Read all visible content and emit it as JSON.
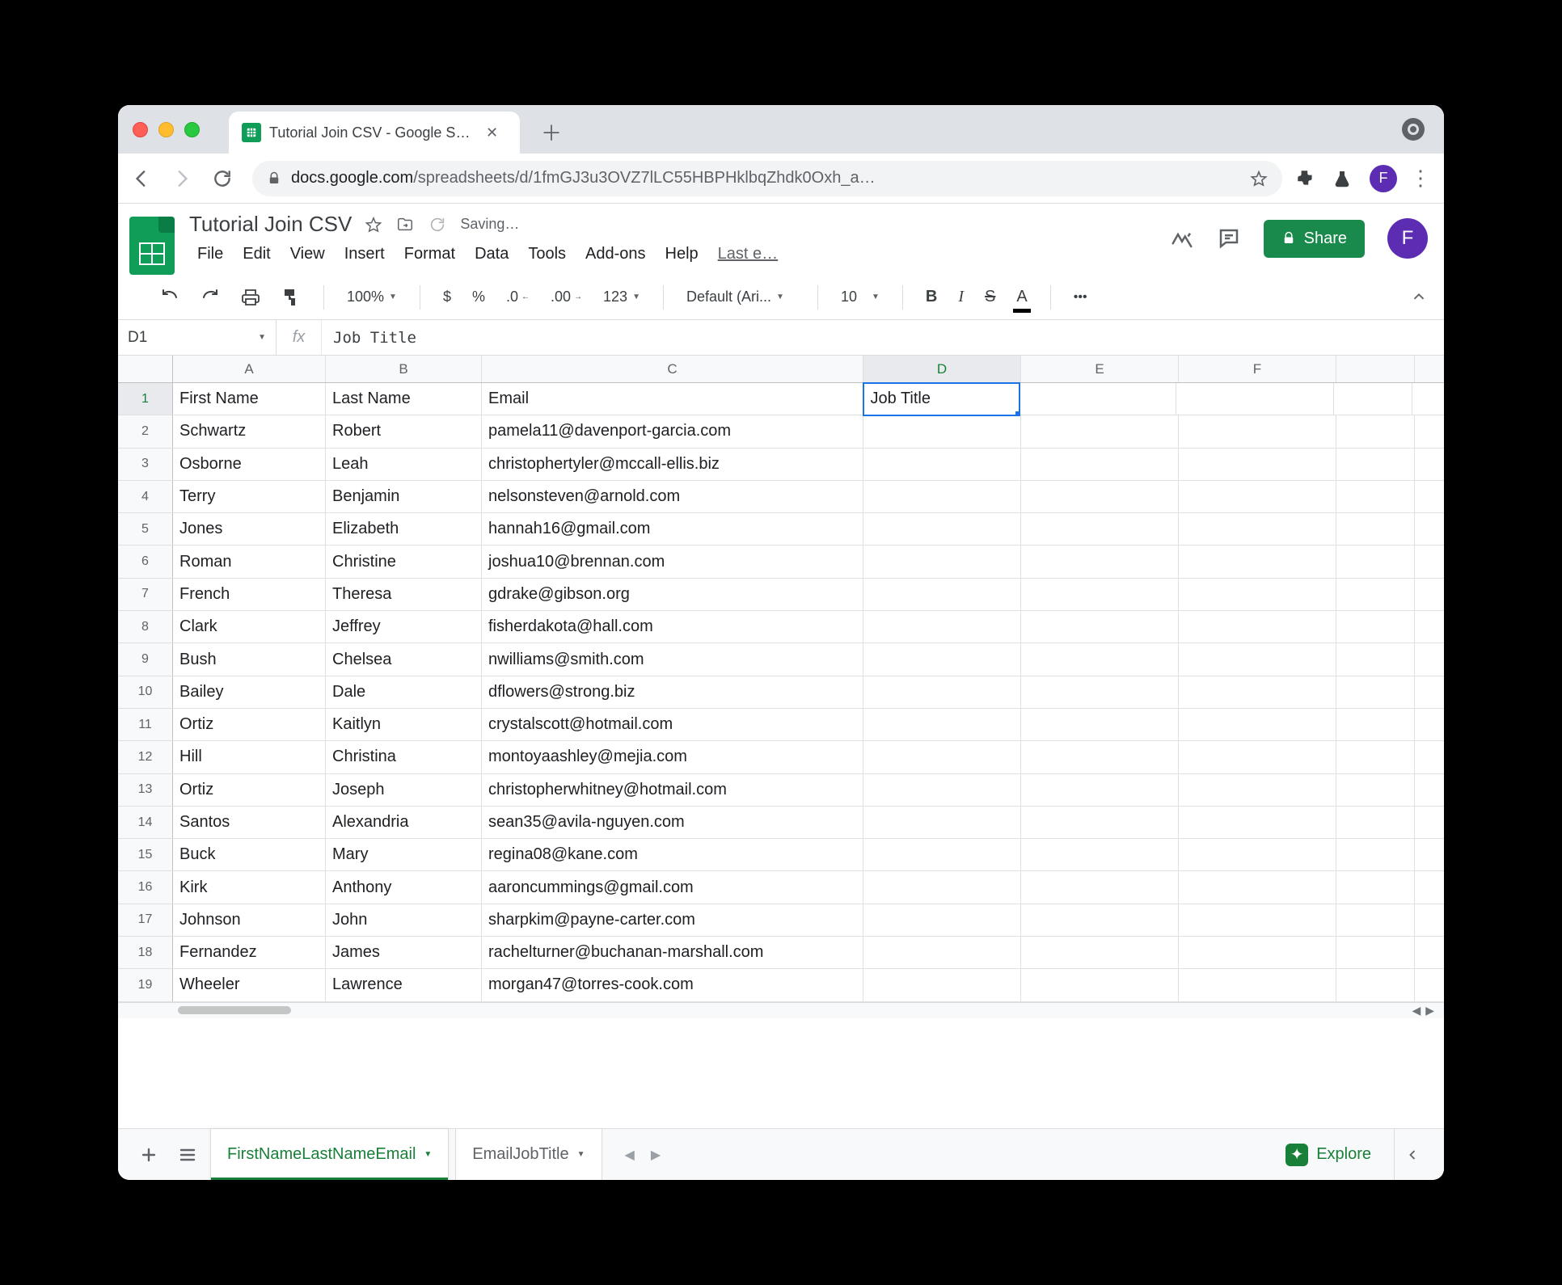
{
  "browser": {
    "tab_title": "Tutorial Join CSV - Google She",
    "url_host": "docs.google.com",
    "url_path": "/spreadsheets/d/1fmGJ3u3OVZ7lLC55HBPHklbqZhdk0Oxh_a…",
    "avatar_letter": "F"
  },
  "doc": {
    "title": "Tutorial Join CSV",
    "saving": "Saving…",
    "share_label": "Share",
    "avatar_letter": "F"
  },
  "menus": [
    "File",
    "Edit",
    "View",
    "Insert",
    "Format",
    "Data",
    "Tools",
    "Add-ons",
    "Help",
    "Last e…"
  ],
  "toolbar": {
    "zoom": "100%",
    "currency": "$",
    "percent": "%",
    "dec_dec": ".0",
    "inc_dec": ".00",
    "more_fmt": "123",
    "font_name": "Default (Ari...",
    "font_size": "10"
  },
  "namebox": "D1",
  "fx": "fx",
  "formula_value": "Job Title",
  "columns": [
    "A",
    "B",
    "C",
    "D",
    "E",
    "F"
  ],
  "selected_cell": {
    "col": "D",
    "row": 1
  },
  "rows": [
    {
      "n": 1,
      "A": "First Name",
      "B": "Last Name",
      "C": "Email",
      "D": "Job Title",
      "E": "",
      "F": ""
    },
    {
      "n": 2,
      "A": "Schwartz",
      "B": "Robert",
      "C": "pamela11@davenport-garcia.com",
      "D": "",
      "E": "",
      "F": ""
    },
    {
      "n": 3,
      "A": "Osborne",
      "B": "Leah",
      "C": "christophertyler@mccall-ellis.biz",
      "D": "",
      "E": "",
      "F": ""
    },
    {
      "n": 4,
      "A": "Terry",
      "B": "Benjamin",
      "C": "nelsonsteven@arnold.com",
      "D": "",
      "E": "",
      "F": ""
    },
    {
      "n": 5,
      "A": "Jones",
      "B": "Elizabeth",
      "C": "hannah16@gmail.com",
      "D": "",
      "E": "",
      "F": ""
    },
    {
      "n": 6,
      "A": "Roman",
      "B": "Christine",
      "C": "joshua10@brennan.com",
      "D": "",
      "E": "",
      "F": ""
    },
    {
      "n": 7,
      "A": "French",
      "B": "Theresa",
      "C": "gdrake@gibson.org",
      "D": "",
      "E": "",
      "F": ""
    },
    {
      "n": 8,
      "A": "Clark",
      "B": "Jeffrey",
      "C": "fisherdakota@hall.com",
      "D": "",
      "E": "",
      "F": ""
    },
    {
      "n": 9,
      "A": "Bush",
      "B": "Chelsea",
      "C": "nwilliams@smith.com",
      "D": "",
      "E": "",
      "F": ""
    },
    {
      "n": 10,
      "A": "Bailey",
      "B": "Dale",
      "C": "dflowers@strong.biz",
      "D": "",
      "E": "",
      "F": ""
    },
    {
      "n": 11,
      "A": "Ortiz",
      "B": "Kaitlyn",
      "C": "crystalscott@hotmail.com",
      "D": "",
      "E": "",
      "F": ""
    },
    {
      "n": 12,
      "A": "Hill",
      "B": "Christina",
      "C": "montoyaashley@mejia.com",
      "D": "",
      "E": "",
      "F": ""
    },
    {
      "n": 13,
      "A": "Ortiz",
      "B": "Joseph",
      "C": "christopherwhitney@hotmail.com",
      "D": "",
      "E": "",
      "F": ""
    },
    {
      "n": 14,
      "A": "Santos",
      "B": "Alexandria",
      "C": "sean35@avila-nguyen.com",
      "D": "",
      "E": "",
      "F": ""
    },
    {
      "n": 15,
      "A": "Buck",
      "B": "Mary",
      "C": "regina08@kane.com",
      "D": "",
      "E": "",
      "F": ""
    },
    {
      "n": 16,
      "A": "Kirk",
      "B": "Anthony",
      "C": "aaroncummings@gmail.com",
      "D": "",
      "E": "",
      "F": ""
    },
    {
      "n": 17,
      "A": "Johnson",
      "B": "John",
      "C": "sharpkim@payne-carter.com",
      "D": "",
      "E": "",
      "F": ""
    },
    {
      "n": 18,
      "A": "Fernandez",
      "B": "James",
      "C": "rachelturner@buchanan-marshall.com",
      "D": "",
      "E": "",
      "F": ""
    },
    {
      "n": 19,
      "A": "Wheeler",
      "B": "Lawrence",
      "C": "morgan47@torres-cook.com",
      "D": "",
      "E": "",
      "F": ""
    }
  ],
  "sheets": {
    "active": "FirstNameLastNameEmail",
    "other": "EmailJobTitle",
    "explore": "Explore"
  }
}
